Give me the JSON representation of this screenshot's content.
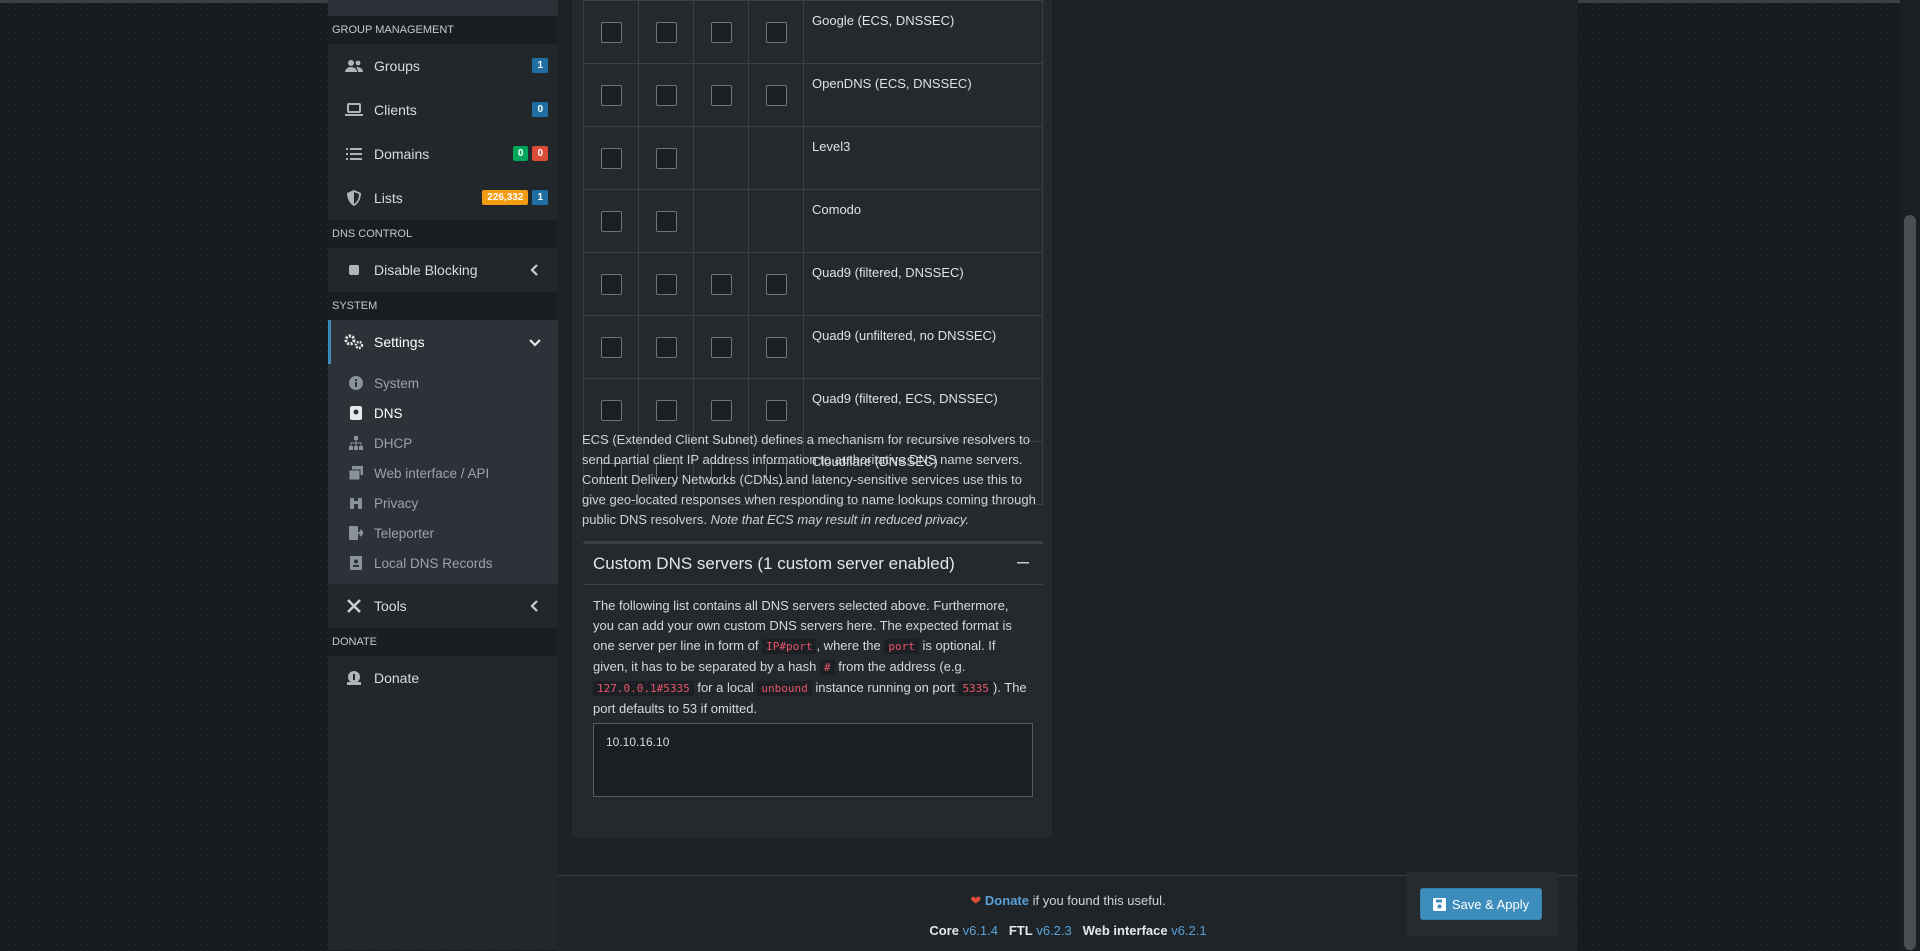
{
  "sidebar": {
    "sections": {
      "group_management": "GROUP MANAGEMENT",
      "dns_control": "DNS CONTROL",
      "system": "SYSTEM",
      "donate": "DONATE"
    },
    "items": {
      "groups": {
        "label": "Groups",
        "badge": "1"
      },
      "clients": {
        "label": "Clients",
        "badge": "0"
      },
      "domains": {
        "label": "Domains",
        "badge_allow": "0",
        "badge_deny": "0"
      },
      "lists": {
        "label": "Lists",
        "badge_count": "226,332",
        "badge_lists": "1"
      },
      "disable_blocking": {
        "label": "Disable Blocking"
      },
      "settings": {
        "label": "Settings"
      },
      "tools": {
        "label": "Tools"
      },
      "donate": {
        "label": "Donate"
      }
    },
    "settings_sub": {
      "system": "System",
      "dns": "DNS",
      "dhcp": "DHCP",
      "web": "Web interface / API",
      "privacy": "Privacy",
      "teleporter": "Teleporter",
      "local_dns": "Local DNS Records"
    }
  },
  "upstream_rows": [
    "Google (ECS, DNSSEC)",
    "OpenDNS (ECS, DNSSEC)",
    "Level3",
    "Comodo",
    "Quad9 (filtered, DNSSEC)",
    "Quad9 (unfiltered, no DNSSEC)",
    "Quad9 (filtered, ECS, DNSSEC)",
    "Cloudflare (DNSSEC)"
  ],
  "ecs_text": "ECS (Extended Client Subnet) defines a mechanism for recursive resolvers to send partial client IP address information to authoritative DNS name servers. Content Delivery Networks (CDNs) and latency-sensitive services use this to give geo-located responses when responding to name lookups coming through public DNS resolvers.",
  "ecs_note": "Note that ECS may result in reduced privacy.",
  "custom_dns": {
    "title": "Custom DNS servers (1 custom server enabled)",
    "p1": "The following list contains all DNS servers selected above. Furthermore, you can add your own custom DNS servers here. The expected format is one server per line in form of",
    "code1": "IP#port",
    "p2": ", where the",
    "code2": "port",
    "p3": "is optional. If given, it has to be separated by a hash",
    "code3": "#",
    "p4": "from the address (e.g.",
    "code4": "127.0.0.1#5335",
    "p5": "for a local",
    "code5": "unbound",
    "p6": "instance running on port",
    "code6": "5335",
    "p7": "). The port defaults to 53 if omitted.",
    "value": "10.10.16.10"
  },
  "footer": {
    "donate_link": "Donate",
    "donate_text": "if you found this useful.",
    "core_label": "Core",
    "core_ver": "v6.1.4",
    "ftl_label": "FTL",
    "ftl_ver": "v6.2.3",
    "web_label": "Web interface",
    "web_ver": "v6.2.1"
  },
  "save_button": "Save & Apply",
  "colors": {
    "accent": "#3c8dbc",
    "heart": "#dd4b39"
  }
}
